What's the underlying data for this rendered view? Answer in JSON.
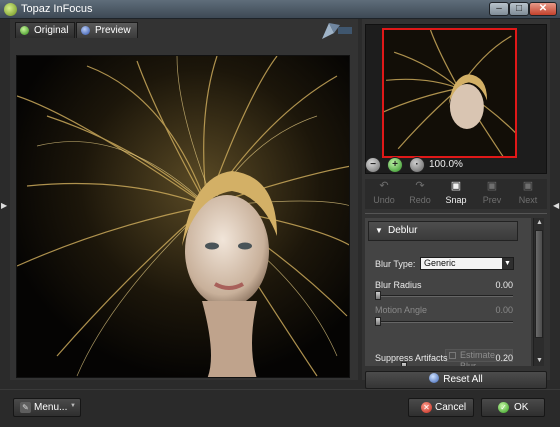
{
  "window": {
    "title": "Topaz InFocus",
    "buttons": {
      "minimize": "–",
      "maximize": "□",
      "close": "✕"
    }
  },
  "view_tabs": [
    {
      "label": "Original",
      "icon": "green-dot-icon"
    },
    {
      "label": "Preview",
      "icon": "blue-dot-icon"
    }
  ],
  "navigator": {
    "zoom": "100.0%"
  },
  "toolbar": {
    "undo": "Undo",
    "redo": "Redo",
    "snap": "Snap",
    "prev": "Prev",
    "next": "Next"
  },
  "deblur": {
    "section_title": "Deblur",
    "blur_type_label": "Blur Type:",
    "blur_type_value": "Generic",
    "blur_radius_label": "Blur Radius",
    "blur_radius_value": "0.00",
    "blur_radius_level": 0.0,
    "motion_angle_label": "Motion Angle",
    "motion_angle_value": "0.00",
    "motion_angle_level": 0.0,
    "estimate_button": "Estimate Blur",
    "suppress_label": "Suppress Artifacts",
    "suppress_value": "0.20",
    "suppress_level": 0.2
  },
  "reset_all": "Reset All",
  "footer": {
    "menu": "Menu...",
    "cancel": "Cancel",
    "ok": "OK"
  },
  "colors": {
    "navigator_frame": "#e01818",
    "accent_green": "#2e9a1b",
    "accent_red": "#c0261a"
  }
}
